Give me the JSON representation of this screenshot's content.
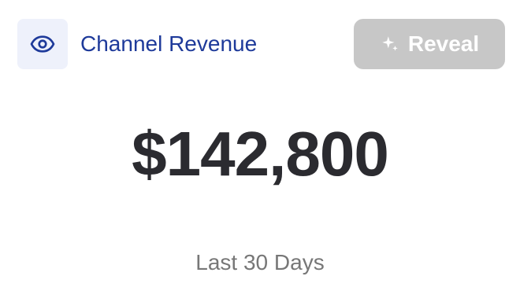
{
  "header": {
    "title": "Channel Revenue",
    "icon": "eye-icon"
  },
  "reveal_button": {
    "label": "Reveal",
    "icon": "sparkles-icon",
    "state": "disabled"
  },
  "metric": {
    "value": "$142,800",
    "period": "Last 30 Days"
  },
  "colors": {
    "accent": "#1e3a9a",
    "icon_bg": "#eef1fb",
    "button_disabled_bg": "#c7c7c7",
    "value_text": "#2b2b30",
    "muted_text": "#777777"
  }
}
